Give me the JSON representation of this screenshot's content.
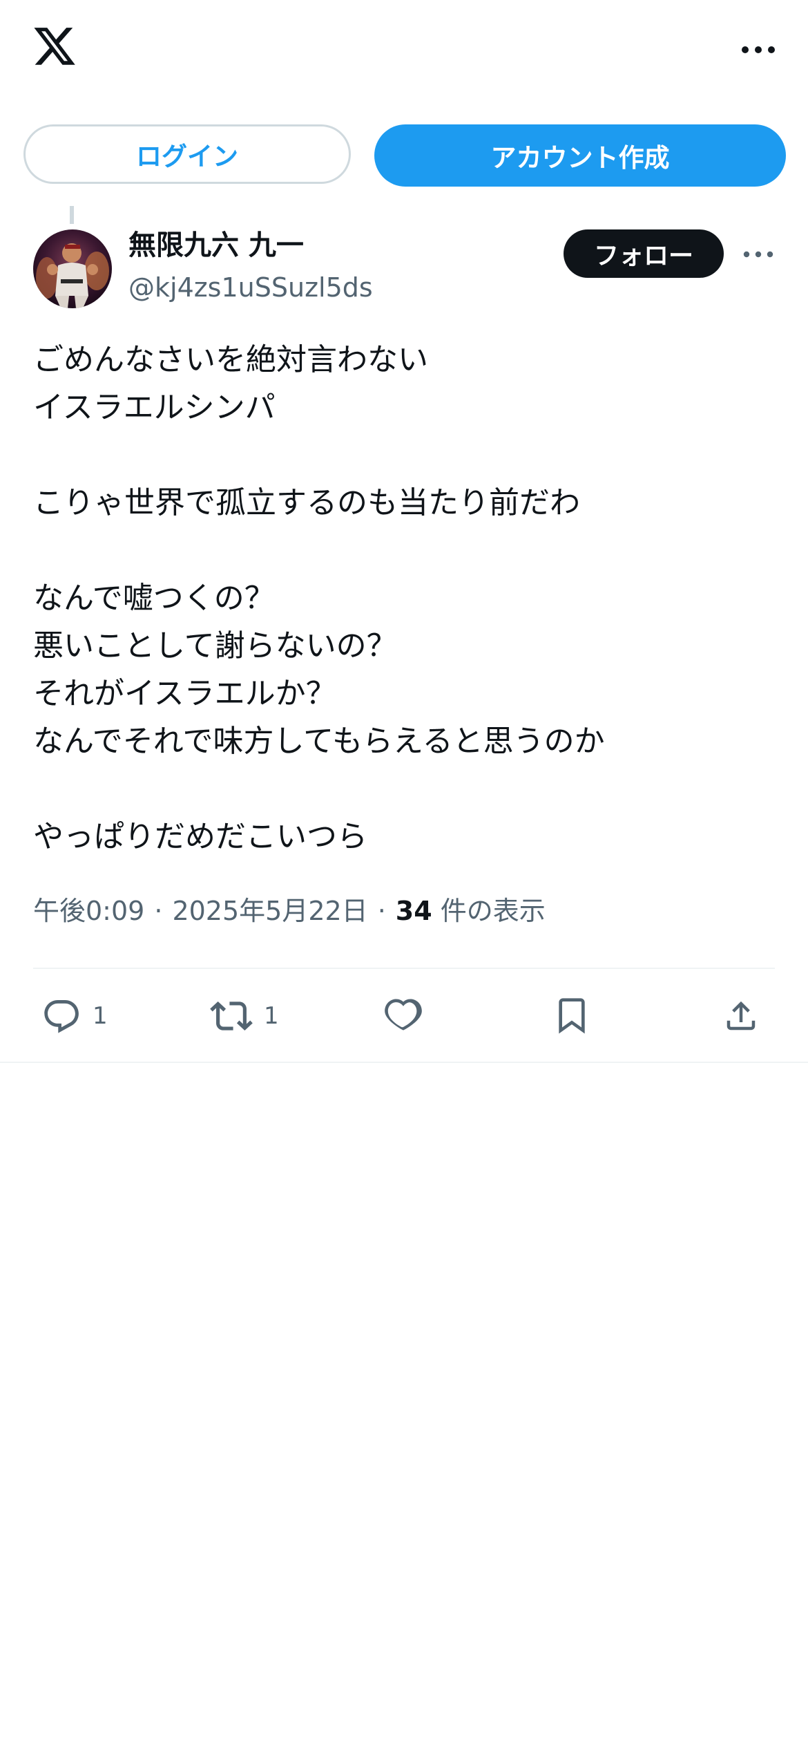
{
  "header": {
    "logo_icon": "x-logo-icon",
    "more_icon": "more-horizontal-icon"
  },
  "auth": {
    "login_label": "ログイン",
    "signup_label": "アカウント作成"
  },
  "tweet": {
    "author": {
      "display_name": "無限九六 九一",
      "handle": "@kj4zs1uSSuzl5ds"
    },
    "follow_label": "フォロー",
    "text_lines": [
      "ごめんなさいを絶対言わない",
      "イスラエルシンパ",
      "",
      "こりゃ世界で孤立するのも当たり前だわ",
      "",
      "なんで嘘つくの？",
      "悪いことして謝らないの？",
      "それがイスラエルか？",
      "なんでそれで味方してもらえると思うのか",
      "",
      "やっぱりだめだこいつら"
    ],
    "time": "午後0:09",
    "date": "2025年5月22日",
    "separator": "·",
    "views_count": "34",
    "views_label": "件の表示",
    "actions": {
      "reply_count": "1",
      "retweet_count": "1",
      "reply_icon": "reply-icon",
      "retweet_icon": "retweet-icon",
      "like_icon": "heart-icon",
      "bookmark_icon": "bookmark-icon",
      "share_icon": "share-icon"
    }
  },
  "colors": {
    "accent": "#1d9bf0",
    "text_primary": "#0f1419",
    "text_secondary": "#536471",
    "border": "#cfd9de"
  }
}
